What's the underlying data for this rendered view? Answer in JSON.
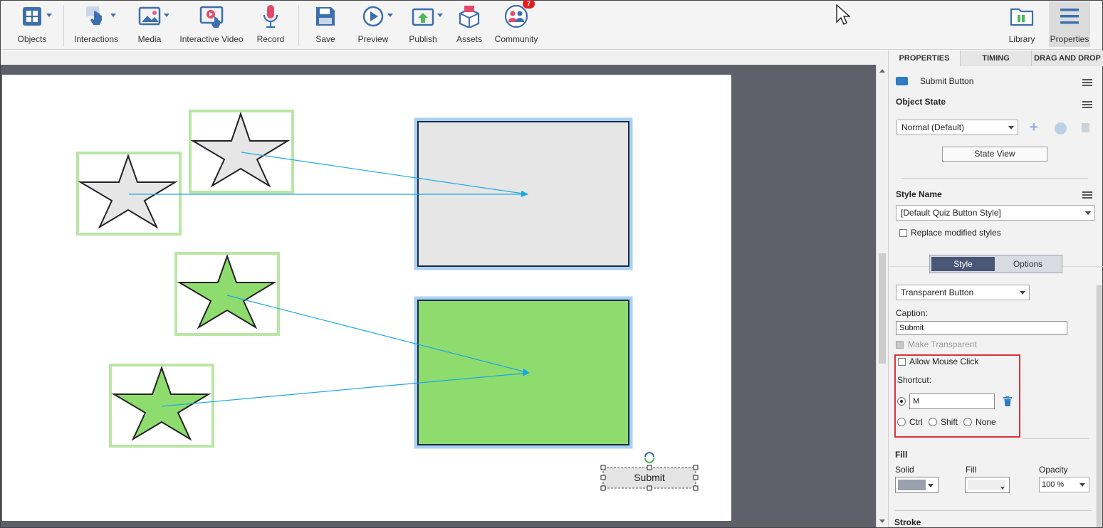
{
  "toolbar": {
    "items": [
      {
        "label": "Objects"
      },
      {
        "label": "Interactions"
      },
      {
        "label": "Media"
      },
      {
        "label": "Interactive Video"
      },
      {
        "label": "Record"
      },
      {
        "label": "Save"
      },
      {
        "label": "Preview"
      },
      {
        "label": "Publish"
      },
      {
        "label": "Assets"
      },
      {
        "label": "Community",
        "badge": "7"
      },
      {
        "label": "Library"
      },
      {
        "label": "Properties"
      }
    ]
  },
  "stage": {
    "submit_label": "Submit"
  },
  "panel": {
    "tabs": [
      {
        "label": "PROPERTIES"
      },
      {
        "label": "TIMING"
      },
      {
        "label": "DRAG AND DROP"
      }
    ],
    "object_name": "Submit Button",
    "object_state_label": "Object State",
    "object_state_value": "Normal (Default)",
    "state_view_label": "State View",
    "style_name_label": "Style Name",
    "style_name_value": "[Default Quiz Button Style]",
    "replace_modified_label": "Replace modified styles",
    "seg_style": "Style",
    "seg_options": "Options",
    "button_type_value": "Transparent Button",
    "caption_label": "Caption:",
    "caption_value": "Submit",
    "make_transparent_label": "Make Transparent",
    "allow_mouse_click_label": "Allow Mouse Click",
    "shortcut_label": "Shortcut:",
    "shortcut_value": "M",
    "ctrl_label": "Ctrl",
    "shift_label": "Shift",
    "none_label": "None",
    "fill_label": "Fill",
    "solid_label": "Solid",
    "fill_sub_label": "Fill",
    "opacity_label": "Opacity",
    "opacity_value": "100 %",
    "stroke_label": "Stroke"
  },
  "colors": {
    "accent": "#3c6fae",
    "star_gray": "#e6e6e6",
    "star_green": "#8edc6e",
    "drop_target_gray": "#e6e6e6",
    "drop_target_green": "#8edc6e",
    "link_line": "#1aa8e6",
    "highlight": "#d8343b"
  }
}
